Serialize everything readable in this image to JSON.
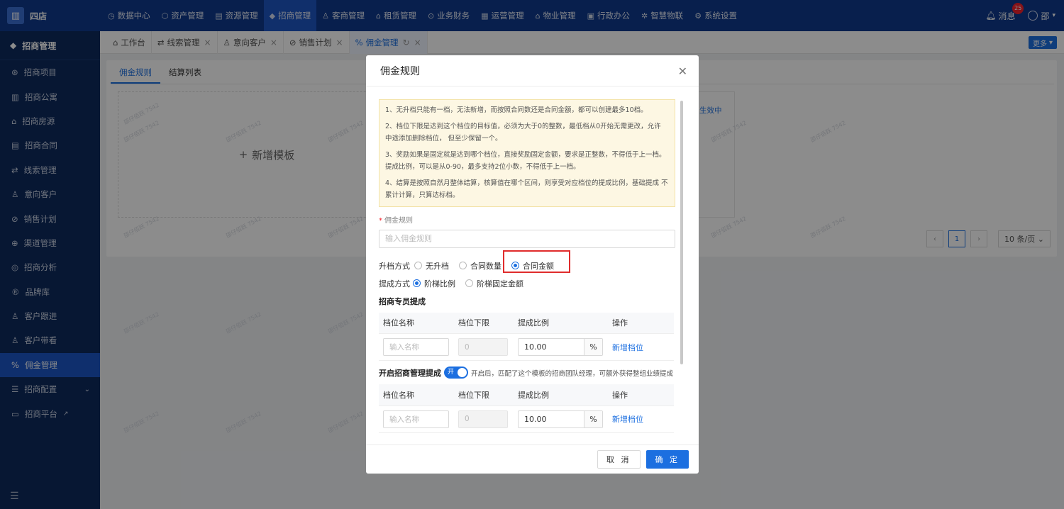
{
  "app": {
    "brand": "四店"
  },
  "topnav": [
    {
      "icon": "◷",
      "label": "数据中心"
    },
    {
      "icon": "⬡",
      "label": "资产管理"
    },
    {
      "icon": "▤",
      "label": "资源管理"
    },
    {
      "icon": "◆",
      "label": "招商管理"
    },
    {
      "icon": "♙",
      "label": "客商管理"
    },
    {
      "icon": "⌂",
      "label": "租赁管理"
    },
    {
      "icon": "⊙",
      "label": "业务财务"
    },
    {
      "icon": "▦",
      "label": "运营管理"
    },
    {
      "icon": "⌂",
      "label": "物业管理"
    },
    {
      "icon": "▣",
      "label": "行政办公"
    },
    {
      "icon": "✲",
      "label": "智慧物联"
    },
    {
      "icon": "⚙",
      "label": "系统设置"
    }
  ],
  "header": {
    "messages_label": "消息",
    "message_count": "25",
    "user": "邵"
  },
  "sidebar": {
    "title": "招商管理",
    "items": [
      {
        "icon": "⊛",
        "label": "招商项目"
      },
      {
        "icon": "▥",
        "label": "招商公寓"
      },
      {
        "icon": "⌂",
        "label": "招商房源"
      },
      {
        "icon": "▤",
        "label": "招商合同"
      },
      {
        "icon": "⇄",
        "label": "线索管理"
      },
      {
        "icon": "♙",
        "label": "意向客户"
      },
      {
        "icon": "⊘",
        "label": "销售计划"
      },
      {
        "icon": "⊕",
        "label": "渠道管理"
      },
      {
        "icon": "◎",
        "label": "招商分析"
      },
      {
        "icon": "®",
        "label": "品牌库"
      },
      {
        "icon": "♙",
        "label": "客户跟进"
      },
      {
        "icon": "♙",
        "label": "客户带看"
      },
      {
        "icon": "%",
        "label": "佣金管理"
      },
      {
        "icon": "☰",
        "label": "招商配置"
      },
      {
        "icon": "▭",
        "label": "招商平台"
      }
    ],
    "footer_icon": "☰"
  },
  "tabs": [
    {
      "icon": "⌂",
      "label": "工作台"
    },
    {
      "icon": "⇄",
      "label": "线索管理"
    },
    {
      "icon": "♙",
      "label": "意向客户"
    },
    {
      "icon": "⊘",
      "label": "销售计划"
    },
    {
      "icon": "%",
      "label": "佣金管理"
    }
  ],
  "more_label": "更多",
  "page": {
    "subtabs": [
      "佣金规则",
      "结算列表"
    ],
    "add_template": "新增模板",
    "status_effective": "生效中",
    "pager": {
      "current": "1",
      "page_size": "10 条/页"
    },
    "watermark": "邵仔佰跃 7542"
  },
  "modal": {
    "title": "佣金规则",
    "notice": [
      "1、无升档只能有一档，无法新增，而按照合同数还是合同金额，都可以创建最多10档。",
      "2、档位下限是达到这个档位的目标值，必须为大于0的整数，最低档从0开始无需更改，允许 中途添加删除档位， 但至少保留一个。",
      "3、奖励如果是固定就是达到哪个档位，直接奖励固定金额，要求是正整数，不得低于上一档。提成比例，可以是从0-90，最多支持2位小数，不得低于上一档。",
      "4、结算是按照自然月整体结算，核算值在哪个区间，则享受对应档位的提成比例，基础提成 不累计计算，只算达标档。"
    ],
    "rule_label": "佣金规则",
    "rule_placeholder": "输入佣金规则",
    "upgrade_label": "升档方式",
    "upgrade_options": [
      "无升档",
      "合同数量",
      "合同金额"
    ],
    "upgrade_selected": "合同金额",
    "commission_label": "提成方式",
    "commission_options": [
      "阶梯比例",
      "阶梯固定金额"
    ],
    "commission_selected": "阶梯比例",
    "section1_title": "招商专员提成",
    "table_headers": [
      "档位名称",
      "档位下限",
      "提成比例",
      "操作"
    ],
    "row": {
      "name_placeholder": "输入名称",
      "lower": "0",
      "ratio": "10.00",
      "unit": "%",
      "action": "新增档位"
    },
    "switch_title": "开启招商管理提成",
    "switch_on": "开",
    "switch_desc": "开启后，匹配了这个模板的招商团队经理，可额外获得整组业绩提成",
    "cancel": "取 消",
    "confirm": "确 定"
  }
}
